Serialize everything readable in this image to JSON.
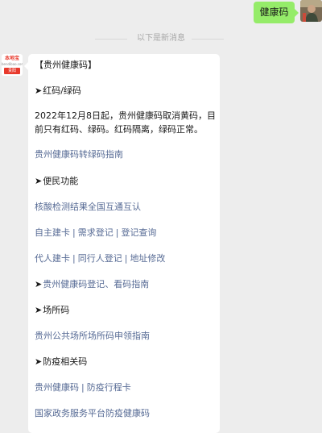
{
  "user_message": {
    "text": "健康码"
  },
  "divider": {
    "text": "以下是新消息"
  },
  "account_avatar": {
    "name": "本地宝",
    "site": "bendibao.com",
    "tag": "贵阳"
  },
  "message": {
    "title": "【贵州健康码】",
    "sections": {
      "s1_heading": "红码/绿码",
      "s1_para": "2022年12月8日起，贵州健康码取消黄码，目前只有红码、绿码。红码隔离，绿码正常。",
      "s1_link": "贵州健康码转绿码指南",
      "s2_heading": "便民功能",
      "s2_link1": "核酸检测结果全国互通互认",
      "s2_link2a": "自主建卡",
      "s2_link2b": "需求登记",
      "s2_link2c": "登记查询",
      "s2_link3a": "代人建卡",
      "s2_link3b": "同行人登记",
      "s2_link3c": "地址修改",
      "s3_heading": "贵州健康码登记、看码指南",
      "s4_heading": "场所码",
      "s4_link": "贵州公共场所场所码申领指南",
      "s5_heading": "防疫相关码",
      "s5_link1a": "贵州健康码",
      "s5_link1b": "防疫行程卡",
      "s5_link2": "国家政务服务平台防疫健康码"
    },
    "arrow_glyph": "➤",
    "separator": "|"
  },
  "colors": {
    "link": "#576b95",
    "user_bubble": "#95ec69",
    "background": "#ededed"
  }
}
